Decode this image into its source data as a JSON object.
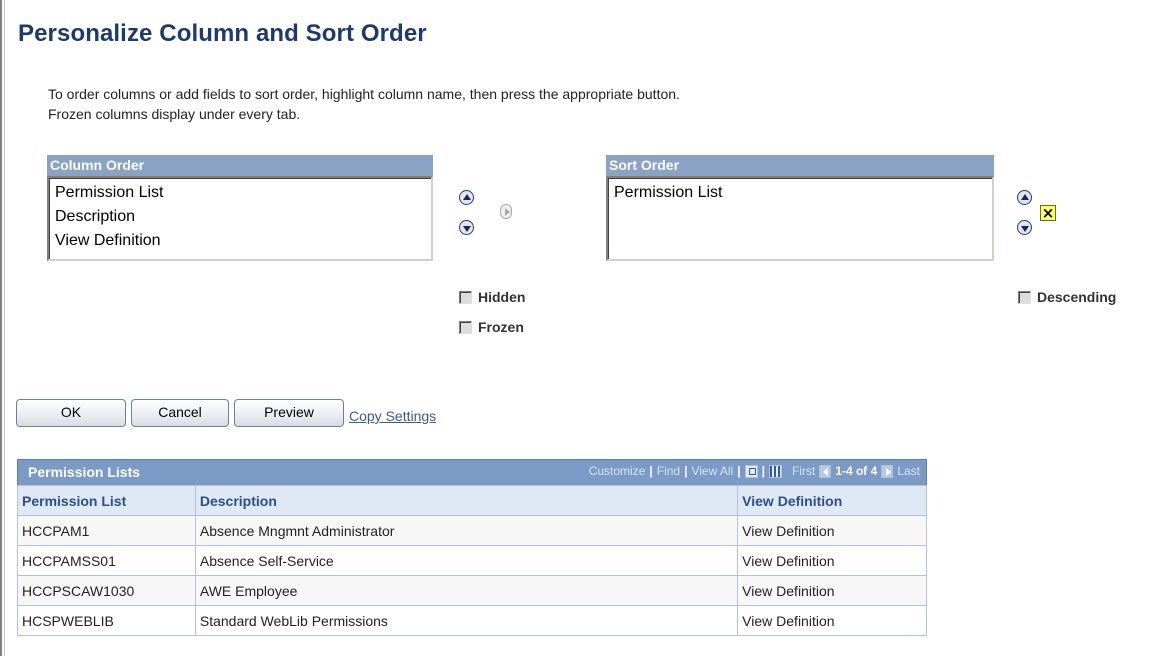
{
  "page": {
    "title": "Personalize Column and Sort Order"
  },
  "instructions": {
    "line1": "To order columns or add fields to sort order, highlight column name, then press the appropriate button.",
    "line2": "Frozen columns display under every tab."
  },
  "column_order": {
    "header": "Column Order",
    "items": [
      "Permission List",
      "Description",
      "View Definition"
    ]
  },
  "sort_order": {
    "header": "Sort Order",
    "items": [
      "Permission List"
    ]
  },
  "options": {
    "hidden_label": "Hidden",
    "frozen_label": "Frozen",
    "descending_label": "Descending",
    "hidden_checked": false,
    "frozen_checked": false,
    "descending_checked": false
  },
  "buttons": {
    "ok": "OK",
    "cancel": "Cancel",
    "preview": "Preview",
    "copy_settings": "Copy Settings"
  },
  "grid": {
    "title": "Permission Lists",
    "nav": {
      "customize": "Customize",
      "find": "Find",
      "view_all": "View All",
      "first": "First",
      "range": "1-4 of 4",
      "last": "Last"
    },
    "columns": [
      "Permission List",
      "Description",
      "View Definition"
    ],
    "rows": [
      [
        "HCCPAM1",
        "Absence Mngmnt Administrator",
        "View Definition"
      ],
      [
        "HCCPAMSS01",
        "Absence Self-Service",
        "View Definition"
      ],
      [
        "HCCPSCAW1030",
        "AWE Employee",
        "View Definition"
      ],
      [
        "HCSPWEBLIB",
        "Standard WebLib Permissions",
        "View Definition"
      ]
    ]
  },
  "colors": {
    "title": "#1d3a6b",
    "listbox_header": "#8aa3c4",
    "grid_header": "#7b9bc6",
    "grid_column_header": "#dfe8f5",
    "link": "#3c5a8f",
    "remove_button": "#ffff66"
  },
  "icons": {
    "move_up": "up-arrow-icon",
    "move_down": "down-arrow-icon",
    "add_to_sort": "right-arrow-icon",
    "remove_from_sort": "close-icon",
    "zoom": "zoom-icon",
    "download": "spreadsheet-icon",
    "prev": "previous-icon",
    "next": "next-icon"
  }
}
